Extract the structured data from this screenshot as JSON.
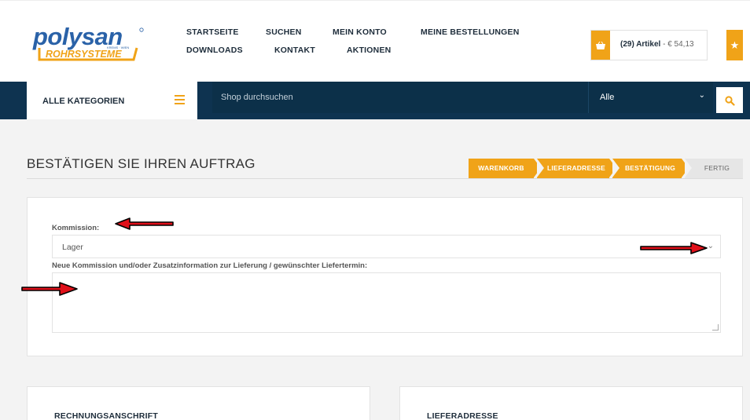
{
  "header": {
    "logo": {
      "brand": "polysan",
      "tagline": "ROHRSYSTEME",
      "subtext": "KREMS · WIEN"
    },
    "nav": {
      "startseite": "STARTSEITE",
      "suchen": "SUCHEN",
      "mein_konto": "MEIN KONTO",
      "meine_bestellungen": "MEINE BESTELLUNGEN",
      "downloads": "DOWNLOADS",
      "kontakt": "KONTAKT",
      "aktionen": "AKTIONEN"
    },
    "cart": {
      "count": "(29) Artikel",
      "separator": " - ",
      "total": "€ 54,13",
      "icon": "basket-icon"
    },
    "wishlist": {
      "icon": "star-icon"
    }
  },
  "searchbar": {
    "categories_label": "ALLE KATEGORIEN",
    "search_placeholder": "Shop durchsuchen",
    "scope_value": "Alle",
    "search_icon": "search-icon"
  },
  "page": {
    "title": "BESTÄTIGEN SIE IHREN AUFTRAG",
    "steps": [
      {
        "label": "WARENKORB",
        "state": "done"
      },
      {
        "label": "LIEFERADRESSE",
        "state": "done"
      },
      {
        "label": "BESTÄTIGUNG",
        "state": "current"
      },
      {
        "label": "FERTIG",
        "state": "todo"
      }
    ]
  },
  "form": {
    "kommission_label": "Kommission:",
    "kommission_value": "Lager",
    "note_label": "Neue Kommission und/oder Zusatzinformation zur Lieferung / gewünschter Liefertermin:",
    "note_value": ""
  },
  "sections": {
    "billing_title": "RECHNUNGSANSCHRIFT",
    "shipping_title": "LIEFERADRESSE"
  },
  "colors": {
    "accent": "#f0a318",
    "navy": "#0e3350",
    "annotation_arrow": "#e0101a"
  }
}
